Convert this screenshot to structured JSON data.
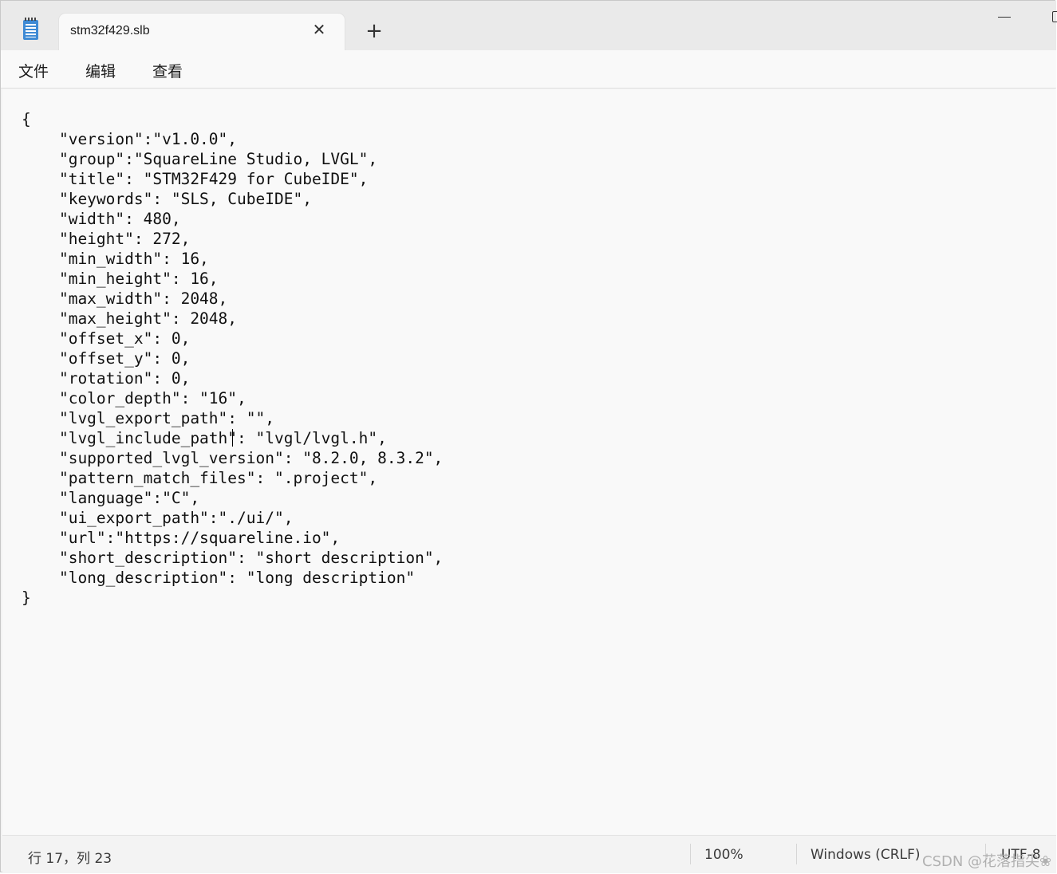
{
  "tab": {
    "title": "stm32f429.slb",
    "close_glyph": "✕",
    "new_tab_glyph": "+"
  },
  "menu": {
    "items": [
      "文件",
      "编辑",
      "查看"
    ]
  },
  "editor": {
    "lines": [
      "{",
      "    \"version\":\"v1.0.0\",",
      "    \"group\":\"SquareLine Studio, LVGL\",",
      "    \"title\": \"STM32F429 for CubeIDE\",",
      "    \"keywords\": \"SLS, CubeIDE\",",
      "    \"width\": 480,",
      "    \"height\": 272,",
      "    \"min_width\": 16,",
      "    \"min_height\": 16,",
      "    \"max_width\": 2048,",
      "    \"max_height\": 2048,",
      "    \"offset_x\": 0,",
      "    \"offset_y\": 0,",
      "    \"rotation\": 0,",
      "    \"color_depth\": \"16\",",
      "    \"lvgl_export_path\": \"\",",
      "    \"lvgl_include_path\": \"lvgl/lvgl.h\",",
      "    \"supported_lvgl_version\": \"8.2.0, 8.3.2\",",
      "    \"pattern_match_files\": \".project\",",
      "    \"language\":\"C\",",
      "    \"ui_export_path\":\"./ui/\",",
      "    \"url\":\"https://squareline.io\",",
      "    \"short_description\": \"short description\",",
      "    \"long_description\": \"long description\"",
      "}"
    ]
  },
  "status": {
    "position": "行 17，列 23",
    "zoom": "100%",
    "line_ending": "Windows (CRLF)",
    "encoding": "UTF-8"
  },
  "watermark": "CSDN @花落指尖❀"
}
